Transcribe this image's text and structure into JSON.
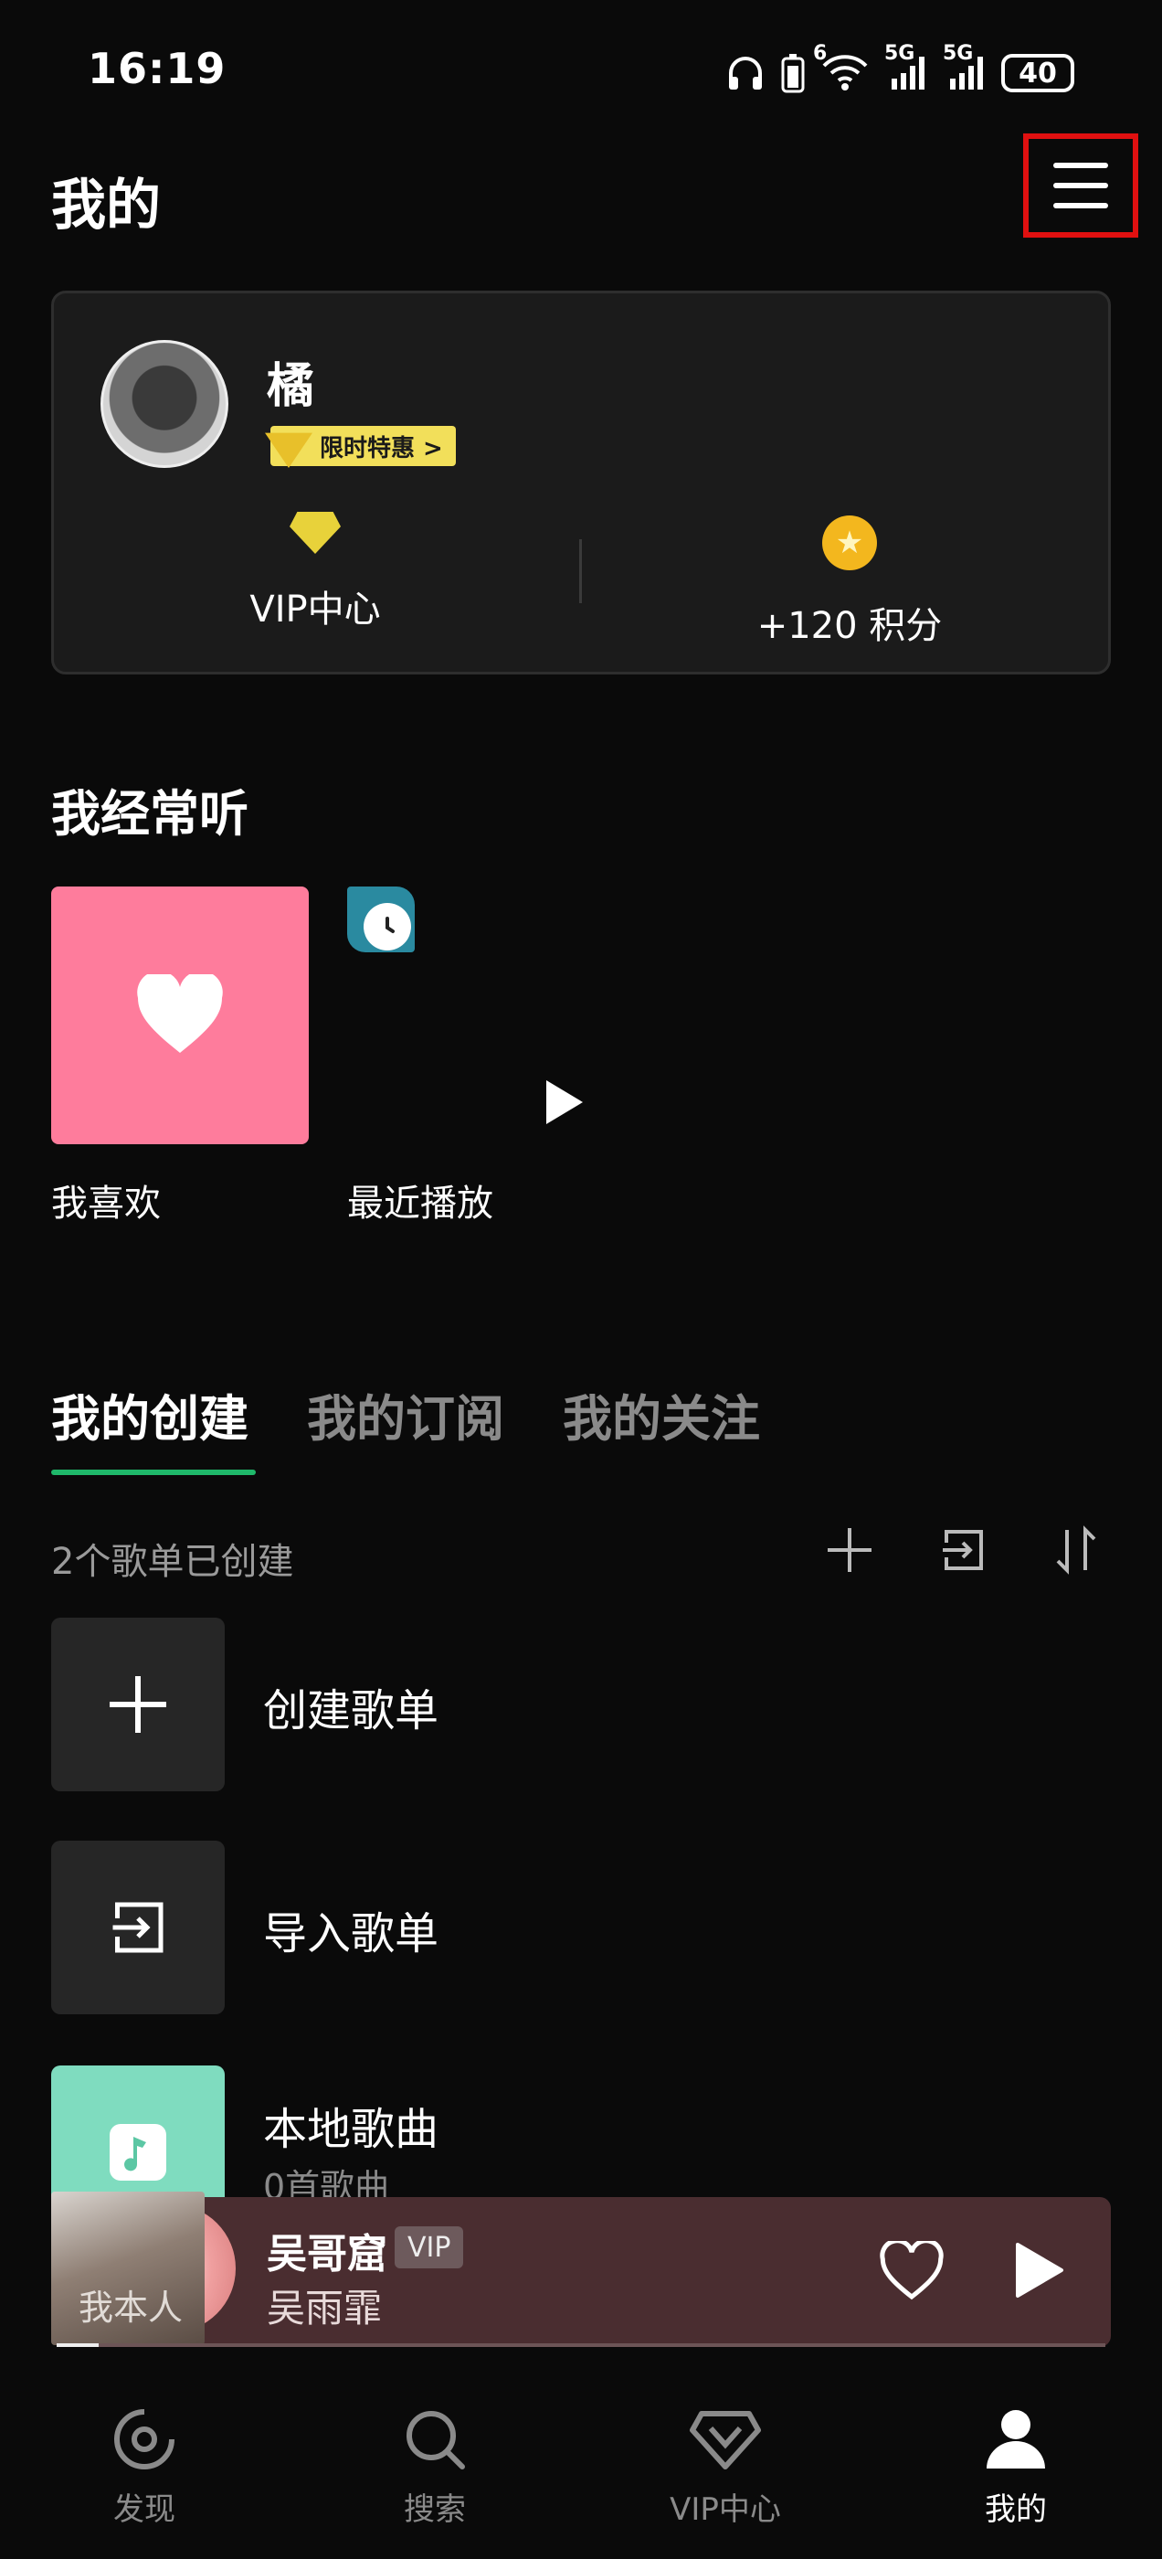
{
  "status_bar": {
    "time": "16:19",
    "signal_labels": [
      "6",
      "5G",
      "5G"
    ],
    "battery": "40"
  },
  "header": {
    "title": "我的",
    "menu_icon": "hamburger-menu-icon"
  },
  "profile": {
    "username": "橘",
    "promo_badge": "限时特惠 >",
    "vip_center_label": "VIP中心",
    "points_label": "+120 积分"
  },
  "frequent": {
    "title": "我经常听",
    "items": [
      {
        "label": "我喜欢",
        "color": "#fe7c9c"
      },
      {
        "label": "最近播放"
      }
    ]
  },
  "tabs": [
    {
      "label": "我的创建",
      "active": true
    },
    {
      "label": "我的订阅",
      "active": false
    },
    {
      "label": "我的关注",
      "active": false
    }
  ],
  "tab_accent": "#1fb86a",
  "created_info": "2个歌单已创建",
  "toolbar_icons": [
    "add-icon",
    "import-icon",
    "sort-icon"
  ],
  "playlists": [
    {
      "label": "创建歌单",
      "icon": "plus-icon"
    },
    {
      "label": "导入歌单",
      "icon": "import-icon"
    },
    {
      "label": "本地歌曲",
      "sub": "0首歌曲",
      "icon": "music-file-icon",
      "color": "#7fdcbf"
    }
  ],
  "now_playing": {
    "title": "吴哥窟",
    "tag": "VIP",
    "artist": "吴雨霏",
    "album_text": "我本人",
    "progress": 0.04
  },
  "bottom_nav": [
    {
      "label": "发现",
      "active": false
    },
    {
      "label": "搜索",
      "active": false
    },
    {
      "label": "VIP中心",
      "active": false
    },
    {
      "label": "我的",
      "active": true
    }
  ]
}
